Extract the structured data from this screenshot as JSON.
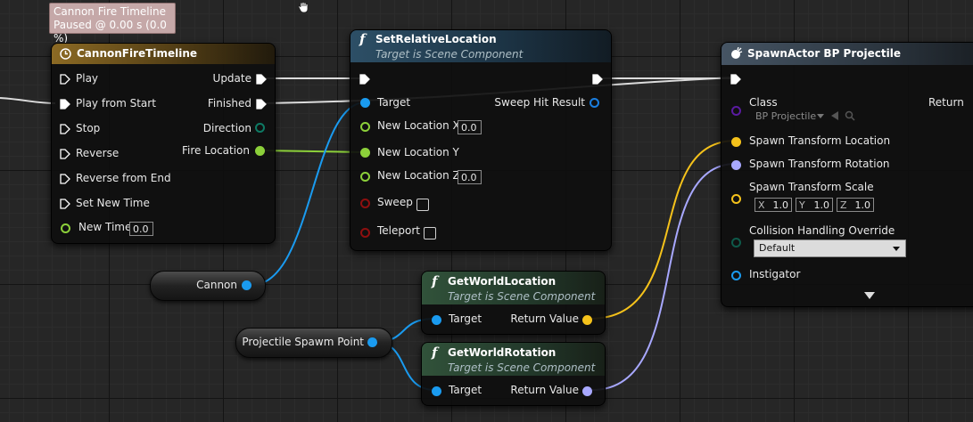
{
  "tooltip": {
    "line1": "Cannon Fire Timeline",
    "line2": "Paused @ 0.00 s (0.0 %)"
  },
  "timeline_node": {
    "title": "CannonFireTimeline",
    "inputs": [
      "Play",
      "Play from Start",
      "Stop",
      "Reverse",
      "Reverse from End",
      "Set New Time"
    ],
    "new_time_label": "New Time",
    "new_time_value": "0.0",
    "outputs": {
      "update": "Update",
      "finished": "Finished",
      "direction": "Direction",
      "fire_location": "Fire Location"
    }
  },
  "set_rel_node": {
    "title": "SetRelativeLocation",
    "subtitle": "Target is Scene Component",
    "target": "Target",
    "sweep_hit": "Sweep Hit Result",
    "new_x_label": "New Location X",
    "new_x_value": "0.0",
    "new_y_label": "New Location Y",
    "new_z_label": "New Location Z",
    "new_z_value": "0.0",
    "sweep": "Sweep",
    "teleport": "Teleport"
  },
  "spawn_node": {
    "title": "SpawnActor BP Projectile",
    "class_label": "Class",
    "return_label": "Return",
    "class_value": "BP Projectile",
    "loc": "Spawn Transform Location",
    "rot": "Spawn Transform Rotation",
    "scale": "Spawn Transform Scale",
    "scale_x": "1.0",
    "scale_y": "1.0",
    "scale_z": "1.0",
    "axis_x": "X",
    "axis_y": "Y",
    "axis_z": "Z",
    "collision": "Collision Handling Override",
    "collision_value": "Default",
    "instigator": "Instigator"
  },
  "get_loc_node": {
    "title": "GetWorldLocation",
    "subtitle": "Target is Scene Component",
    "target": "Target",
    "ret": "Return Value"
  },
  "get_rot_node": {
    "title": "GetWorldRotation",
    "subtitle": "Target is Scene Component",
    "target": "Target",
    "ret": "Return Value"
  },
  "cannon_var": {
    "label": "Cannon"
  },
  "spawn_point_var": {
    "label": "Projectile Spawm Point"
  },
  "colors": {
    "exec": "#ffffff",
    "object": "#1a9bf0",
    "float": "#8cd03a",
    "vector": "#f5c21b",
    "rotator": "#a8a8ff",
    "bool": "#8e0f0f",
    "class": "#5a1ba0",
    "enum": "#0e5a4a",
    "struct": "#0a65b5",
    "timeline_header": "#8c6a24",
    "function_header": "#2d4f66",
    "pure_header": "#31523a",
    "spawn_header": "#465564"
  }
}
